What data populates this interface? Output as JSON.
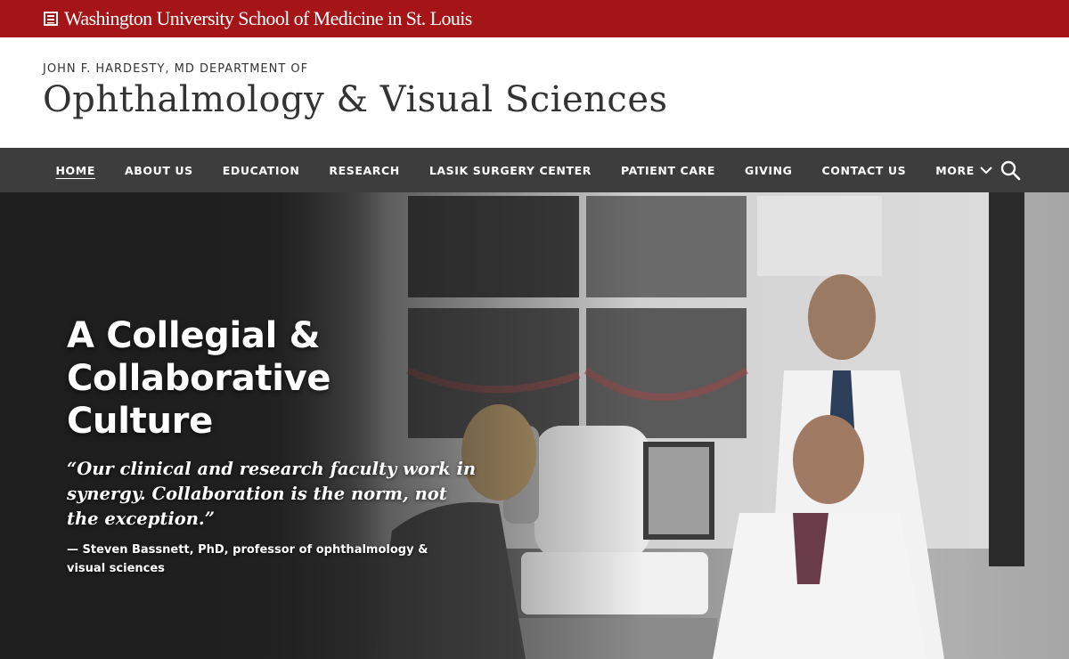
{
  "brand": {
    "university_name": "Washington University School of Medicine in St. Louis",
    "color": "#a51417"
  },
  "masthead": {
    "department_prefix": "JOHN F. HARDESTY, MD DEPARTMENT OF",
    "department_title": "Ophthalmology & Visual Sciences"
  },
  "nav": {
    "items": [
      {
        "label": "HOME",
        "active": true
      },
      {
        "label": "ABOUT US"
      },
      {
        "label": "EDUCATION"
      },
      {
        "label": "RESEARCH"
      },
      {
        "label": "LASIK SURGERY CENTER"
      },
      {
        "label": "PATIENT CARE"
      },
      {
        "label": "GIVING"
      },
      {
        "label": "CONTACT US"
      }
    ],
    "more_label": "MORE",
    "more_icon": "chevron-down-icon",
    "search_icon": "search-icon"
  },
  "hero": {
    "heading_line1": "A Collegial &",
    "heading_line2": "Collaborative Culture",
    "quote": "“Our clinical and research faculty work in synergy. Collaboration is the norm, not the exception.”",
    "attribution": "— Steven Bassnett, PhD, professor of ophthalmology & visual sciences"
  }
}
